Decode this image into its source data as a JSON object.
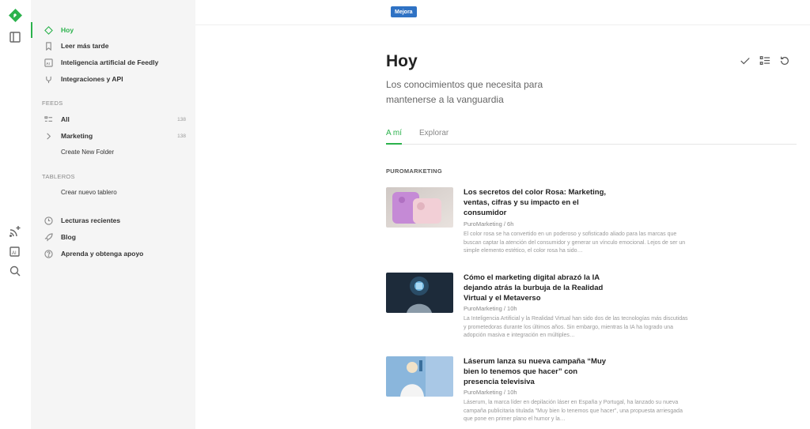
{
  "colors": {
    "accent": "#2bb24c",
    "badge": "#2f72c4"
  },
  "topbar": {
    "badge": "Mejora"
  },
  "rail": {
    "icons": [
      "feedly-logo-icon",
      "sidebar-toggle-icon",
      "add-feed-icon",
      "ai-feed-icon",
      "search-icon"
    ]
  },
  "sidebar": {
    "nav": [
      {
        "label": "Hoy",
        "icon": "today-icon"
      },
      {
        "label": "Leer más tarde",
        "icon": "bookmark-icon"
      },
      {
        "label": "Inteligencia artificial de Feedly",
        "icon": "ai-icon"
      },
      {
        "label": "Integraciones y API",
        "icon": "plug-icon"
      }
    ],
    "feeds_header": "FEEDS",
    "feeds": [
      {
        "label": "All",
        "count": "138"
      },
      {
        "label": "Marketing",
        "count": "138"
      }
    ],
    "create_folder": "Create New Folder",
    "boards_header": "TABLEROS",
    "create_board": "Crear nuevo tablero",
    "footer": [
      {
        "label": "Lecturas recientes",
        "icon": "clock-icon"
      },
      {
        "label": "Blog",
        "icon": "rocket-icon"
      },
      {
        "label": "Aprenda y obtenga apoyo",
        "icon": "help-icon"
      }
    ]
  },
  "main": {
    "title": "Hoy",
    "subtitle": "Los conocimientos que necesita para mantenerse a la vanguardia",
    "tabs": [
      "A mí",
      "Explorar"
    ],
    "source": "PUROMARKETING",
    "articles": [
      {
        "title": "Los secretos del color Rosa: Marketing, ventas, cifras y su impacto en el consumidor",
        "meta": "PuroMarketing / 6h",
        "desc": "El color rosa se ha convertido en un poderoso y sofisticado aliado para las marcas que buscan captar la atención del consumidor y generar un vínculo emocional. Lejos de ser un simple elemento estético, el color rosa ha sido…"
      },
      {
        "title": "Cómo el marketing digital abrazó la IA dejando atrás la burbuja de la Realidad Virtual y el Metaverso",
        "meta": "PuroMarketing / 10h",
        "desc": "La Inteligencia Artificial y la Realidad Virtual han sido dos de las tecnologías más discutidas y prometedoras durante los últimos años. Sin embargo, mientras la IA ha logrado una adopción masiva e integración en múltiples…"
      },
      {
        "title": "Láserum lanza su nueva campaña “Muy bien lo tenemos que hacer” con presencia televisiva",
        "meta": "PuroMarketing / 10h",
        "desc": "Láserum, la marca líder en depilación láser en España y Portugal, ha lanzado su nueva campaña publicitaria titulada \"Muy bien lo tenemos que hacer\", una propuesta arriesgada que pone en primer plano el humor y la…"
      }
    ]
  }
}
